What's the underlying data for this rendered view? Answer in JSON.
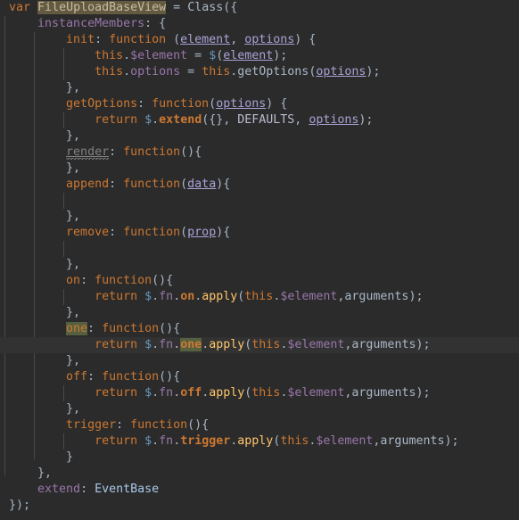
{
  "editor": {
    "language": "JavaScript",
    "theme": "Darcula",
    "background_color": "#2b2b2b",
    "current_line_color": "#323232",
    "selection_color": "#645a41",
    "usage_highlight_color": "#56603f",
    "indent_guide_color": "#484848",
    "default_text_color": "#a9b7c6",
    "keyword_color": "#cc7832",
    "field_color": "#9876aa",
    "parameter_color": "#a9a2d6",
    "method_color": "#ffc66d",
    "dollar_color": "#6897bb",
    "class_color": "#a9c7e8",
    "warning_text_color": "#808080",
    "current_line_number": 20,
    "font_size_px": 13.3,
    "line_height_px": 18
  },
  "code": {
    "full_text": "var FileUploadBaseView = Class({\n    instanceMembers: {\n        init: function (element, options) {\n            this.$element = $(element);\n            this.options = this.getOptions(options);\n        },\n        getOptions: function(options) {\n            return $.extend({}, DEFAULTS, options);\n        },\n        render: function(){\n        },\n        append: function(data){\n\n        },\n        remove: function(prop){\n\n        },\n        on: function(){\n            return $.fn.on.apply(this.$element,arguments);\n        },\n        one: function(){\n            return $.fn.one.apply(this.$element,arguments);\n        },\n        off: function(){\n            return $.fn.off.apply(this.$element,arguments);\n        },\n        trigger: function(){\n            return $.fn.trigger.apply(this.$element,arguments);\n        }\n    },\n    extend: EventBase\n});",
    "lines": [
      "var FileUploadBaseView = Class({",
      "    instanceMembers: {",
      "        init: function (element, options) {",
      "            this.$element = $(element);",
      "            this.options = this.getOptions(options);",
      "        },",
      "        getOptions: function(options) {",
      "            return $.extend({}, DEFAULTS, options);",
      "        },",
      "        render: function(){",
      "        },",
      "        append: function(data){",
      "",
      "        },",
      "        remove: function(prop){",
      "",
      "        },",
      "        on: function(){",
      "            return $.fn.on.apply(this.$element,arguments);",
      "        },",
      "        one: function(){",
      "            return $.fn.one.apply(this.$element,arguments);",
      "        },",
      "        off: function(){",
      "            return $.fn.off.apply(this.$element,arguments);",
      "        },",
      "        trigger: function(){",
      "            return $.fn.trigger.apply(this.$element,arguments);",
      "        }",
      "    },",
      "    extend: EventBase",
      "});"
    ],
    "selected_text": "FileUploadBaseView",
    "highlighted_symbol": "one",
    "warned_symbol": "render",
    "identifiers": {
      "class_name": "FileUploadBaseView",
      "base_class": "EventBase",
      "factory": "Class",
      "defaults_const": "DEFAULTS",
      "members_key": "instanceMembers",
      "extend_key": "extend"
    },
    "methods": [
      "init",
      "getOptions",
      "render",
      "append",
      "remove",
      "on",
      "one",
      "off",
      "trigger"
    ],
    "parameters": [
      "element",
      "options",
      "data",
      "prop"
    ]
  }
}
